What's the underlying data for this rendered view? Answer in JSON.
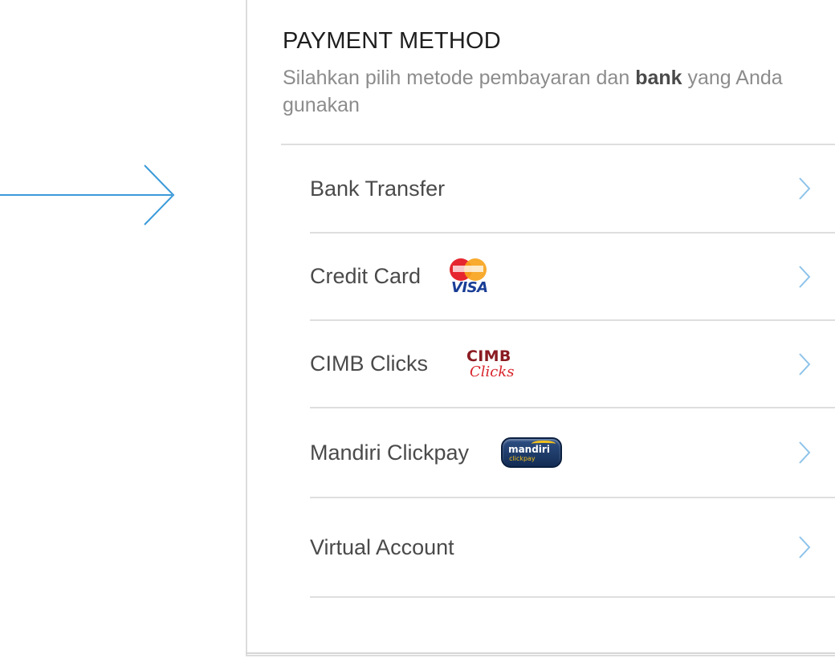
{
  "header": {
    "title": "PAYMENT METHOD",
    "subtitle_pre": "Silahkan pilih metode pembayaran dan",
    "subtitle_bold": "bank",
    "subtitle_post": "yang Anda gunakan"
  },
  "methods": [
    {
      "label": "Bank Transfer",
      "icon": "none"
    },
    {
      "label": "Credit Card",
      "icon": "mastercard-visa-logo"
    },
    {
      "label": "CIMB Clicks",
      "icon": "cimb-clicks-logo",
      "logo_line1": "CIMB",
      "logo_line2": "Clicks"
    },
    {
      "label": "Mandiri Clickpay",
      "icon": "mandiri-clickpay-logo"
    },
    {
      "label": "Virtual Account",
      "icon": "none"
    }
  ],
  "colors": {
    "accent_arrow": "#3a9ad9",
    "chevron": "#8dc3ea",
    "divider": "#dedede",
    "title": "#1e1e1e",
    "subtitle": "#8c8c8c"
  }
}
